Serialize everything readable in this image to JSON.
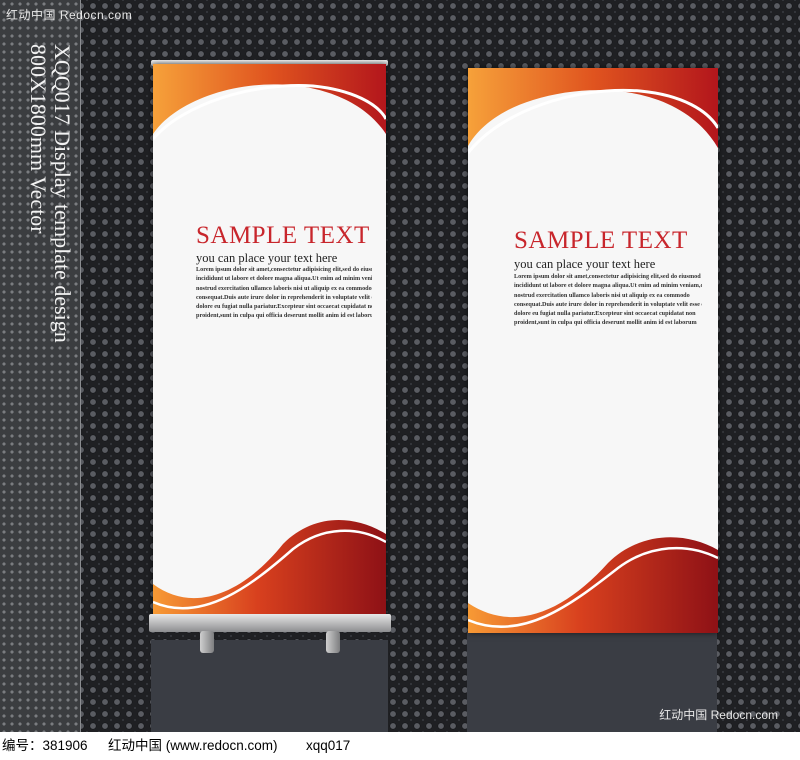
{
  "watermark_top": "红动中国 Redocn.com",
  "side_title_lines": [
    "XQQ017 Display template design",
    "800X1800mm Vector"
  ],
  "banners": [
    {
      "title": "SAMPLE TEXT",
      "subtitle": "you can place your text here",
      "lorem": [
        "Lorem ipsum dolor sit amet,consectetur adipisicing elit,sed do eiusmod tempor",
        "incididunt ut labore et dolore magna aliqua.Ut enim ad minim veniam,quis",
        "nostrud exercitation ullamco laboris nisi ut aliquip ex ea commodo",
        "consequat.Duis aute irure dolor in reprehenderit in voluptate velit esse cillum",
        "dolore eu fugiat nulla pariatur.Excepteur sint occaecat cupidatat non",
        "proident,sunt in culpa qui officia deserunt mollit anim id est laborum"
      ]
    },
    {
      "title": "SAMPLE TEXT",
      "subtitle": "you can place your text here",
      "lorem": [
        "Lorem ipsum dolor sit amet,consectetur adipisicing elit,sed do eiusmod tempor",
        "incididunt ut labore et dolore magna aliqua.Ut enim ad minim veniam,quis",
        "nostrud exercitation ullamco laboris nisi ut aliquip ex ea commodo",
        "consequat.Duis aute irure dolor in reprehenderit in voluptate velit esse cillum",
        "dolore eu fugiat nulla pariatur.Excepteur sint occaecat cupidatat non",
        "proident,sunt in culpa qui officia deserunt mollit anim id est laborum"
      ]
    }
  ],
  "watermark_bottom": "红动中国 Redocn.com",
  "footer": {
    "id_label": "编号：381906",
    "site": "红动中国 (www.redocn.com)",
    "author": "xqq017"
  },
  "colors": {
    "accent_red": "#c8262c",
    "accent_orange": "#f08a2a",
    "dark_red": "#8e1116"
  }
}
